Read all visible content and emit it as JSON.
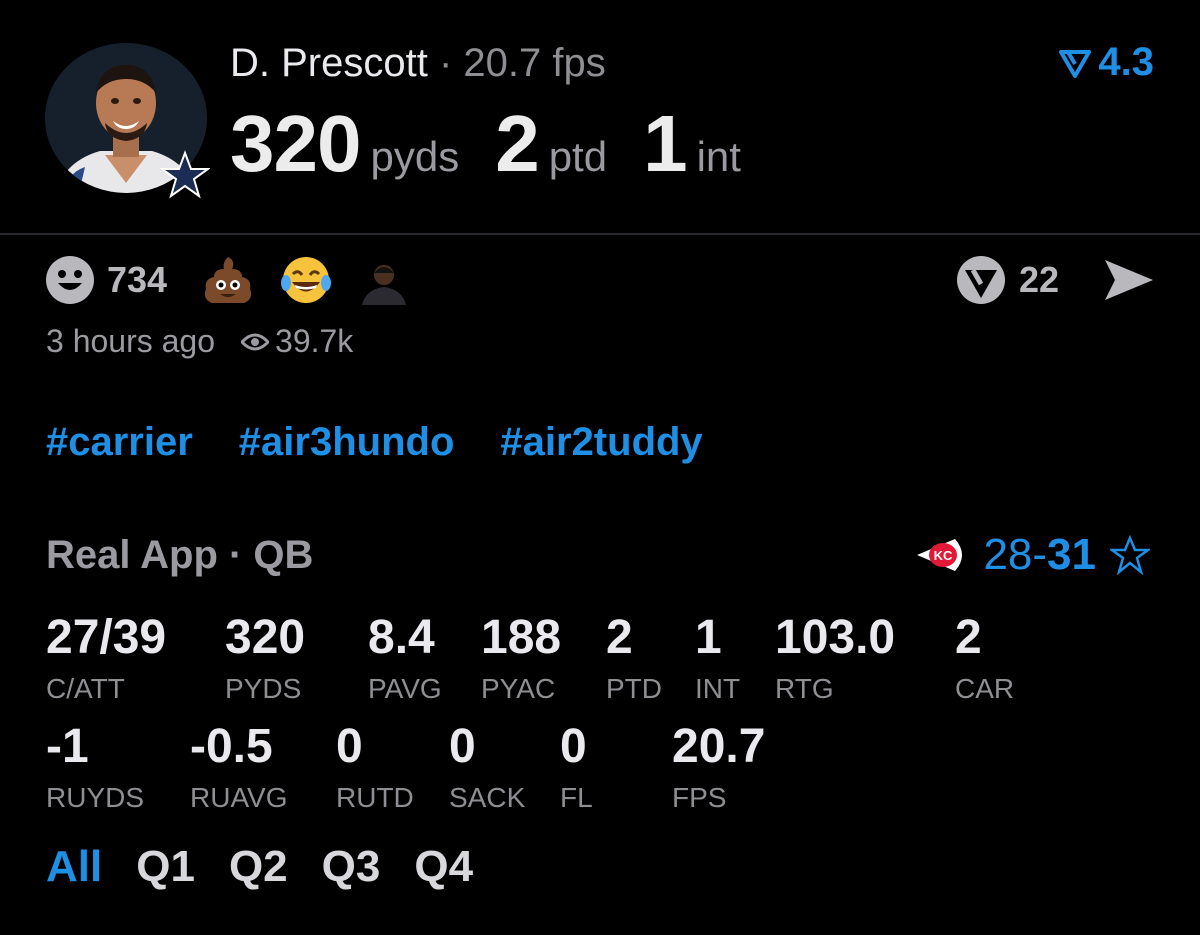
{
  "player": {
    "name": "D. Prescott",
    "fps_text": "20.7 fps",
    "stats": [
      {
        "value": "320",
        "unit": "pyds"
      },
      {
        "value": "2",
        "unit": "ptd"
      },
      {
        "value": "1",
        "unit": "int"
      }
    ],
    "projection": "4.3"
  },
  "reactions": {
    "smile_count": "734",
    "comment_count": "22"
  },
  "meta": {
    "time_ago": "3 hours ago",
    "views": "39.7k"
  },
  "hashtags": [
    "#carrier",
    "#air3hundo",
    "#air2tuddy"
  ],
  "game": {
    "title": "Real App · QB",
    "away_score": "28",
    "separator": "-",
    "home_score": "31"
  },
  "stat_rows": [
    [
      {
        "value": "27/39",
        "label": "C/ATT"
      },
      {
        "value": "320",
        "label": "PYDS"
      },
      {
        "value": "8.4",
        "label": "PAVG"
      },
      {
        "value": "188",
        "label": "PYAC"
      },
      {
        "value": "2",
        "label": "PTD"
      },
      {
        "value": "1",
        "label": "INT"
      },
      {
        "value": "103.0",
        "label": "RTG"
      },
      {
        "value": "2",
        "label": "CAR"
      }
    ],
    [
      {
        "value": "-1",
        "label": "RUYDS"
      },
      {
        "value": "-0.5",
        "label": "RUAVG"
      },
      {
        "value": "0",
        "label": "RUTD"
      },
      {
        "value": "0",
        "label": "SACK"
      },
      {
        "value": "0",
        "label": "FL"
      },
      {
        "value": "20.7",
        "label": "FPS"
      }
    ]
  ],
  "quarter_tabs": [
    "All",
    "Q1",
    "Q2",
    "Q3",
    "Q4"
  ],
  "colors": {
    "accent": "#1f8fe5",
    "dim": "#8e8e93"
  }
}
